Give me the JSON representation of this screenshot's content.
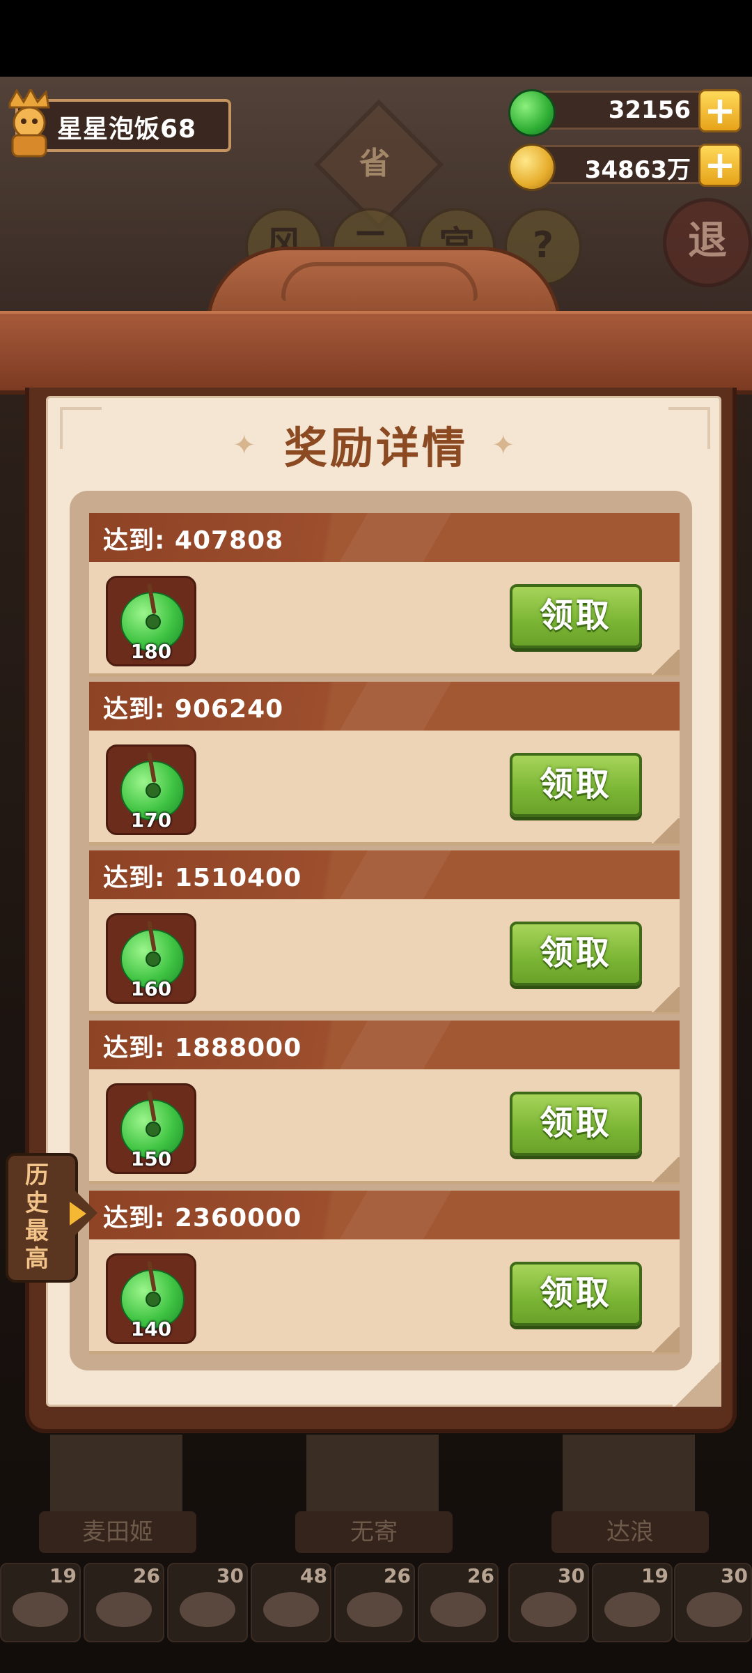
{
  "player": {
    "name": "星星泡饭68"
  },
  "resources": {
    "jade": "32156",
    "coins": "34863万"
  },
  "background": {
    "sign": "省",
    "exit": "退",
    "buttons": [
      "风",
      "二",
      "宫",
      "?"
    ]
  },
  "panel": {
    "title": "奖励详情",
    "rows": [
      {
        "target": "达到: 407808",
        "reward": "180",
        "claim": "领取"
      },
      {
        "target": "达到: 906240",
        "reward": "170",
        "claim": "领取"
      },
      {
        "target": "达到: 1510400",
        "reward": "160",
        "claim": "领取"
      },
      {
        "target": "达到: 1888000",
        "reward": "150",
        "claim": "领取"
      },
      {
        "target": "达到: 2360000",
        "reward": "140",
        "claim": "领取"
      }
    ]
  },
  "history_tab": {
    "label": "历史最高"
  },
  "characters": [
    "麦田姬",
    "无寄",
    "达浪"
  ],
  "dishes": [
    "19",
    "26",
    "30",
    "48",
    "26",
    "26",
    "30",
    "19",
    "30"
  ]
}
